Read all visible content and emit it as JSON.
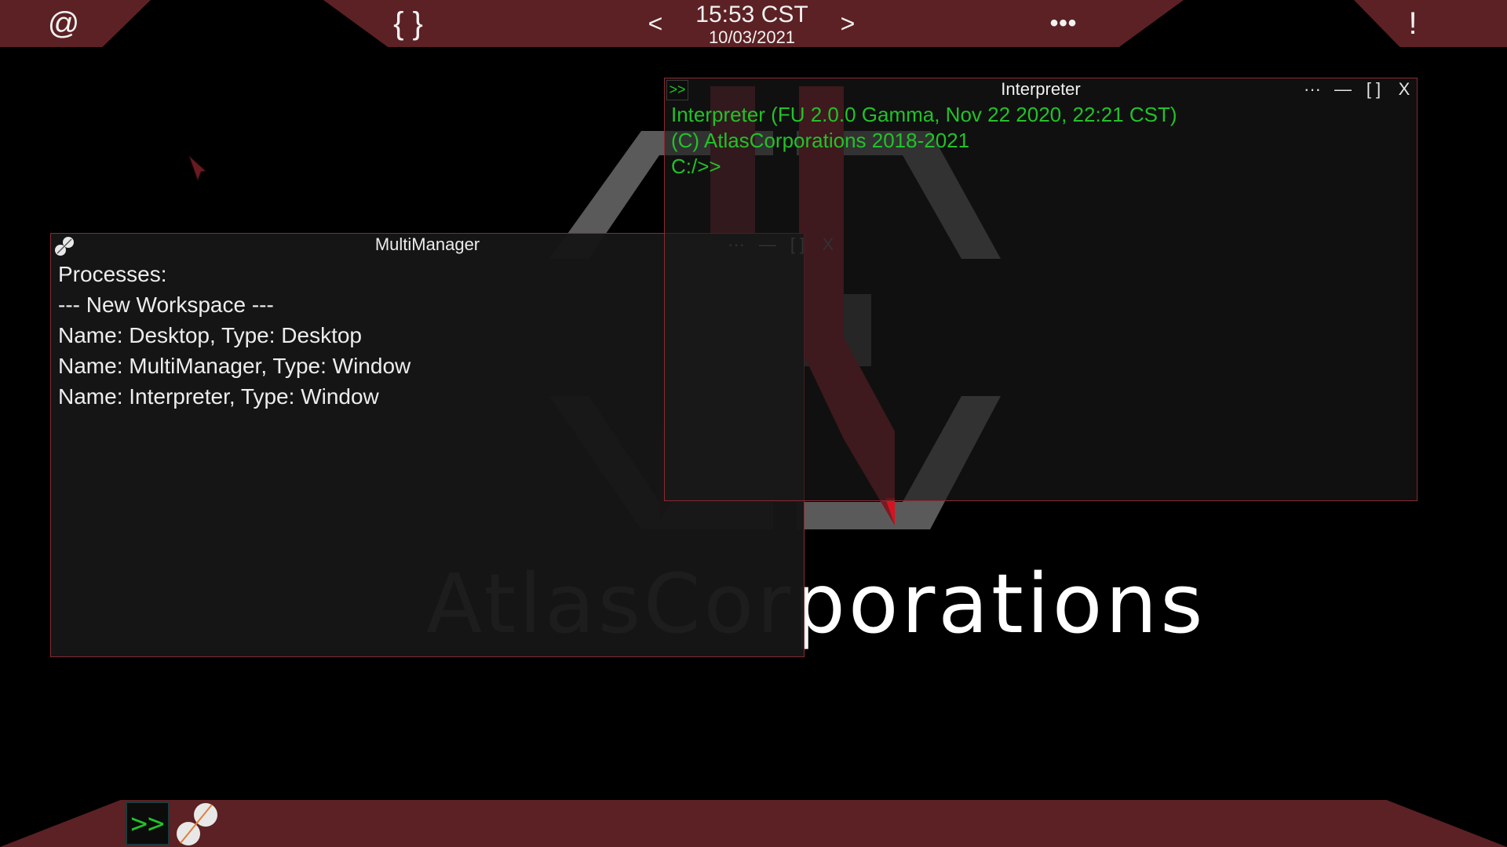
{
  "topbar": {
    "left_button": "@",
    "braces_button": "{ }",
    "prev_button": "<",
    "time": "15:53 CST",
    "date": "10/03/2021",
    "next_button": ">",
    "more_button": "•••",
    "alert_button": "!"
  },
  "wallpaper": {
    "logo_text": "AtlasCorporations"
  },
  "multimanager": {
    "title": "MultiManager",
    "controls": {
      "more": "···",
      "minimize": "—",
      "maximize": "[ ]",
      "close": "X"
    },
    "lines": [
      "Processes:",
      "--- New Workspace ---",
      "Name: Desktop, Type: Desktop",
      "Name: MultiManager, Type: Window",
      "Name: Interpreter, Type: Window"
    ]
  },
  "interpreter": {
    "title": "Interpreter",
    "icon_text": ">>",
    "controls": {
      "more": "···",
      "minimize": "—",
      "maximize": "[ ]",
      "close": "X"
    },
    "lines": [
      "Interpreter (FU 2.0.0 Gamma, Nov 22 2020, 22:21 CST)",
      "(C) AtlasCorporations 2018-2021",
      "C:/>>"
    ]
  },
  "taskbar": {
    "terminal_label": ">>",
    "apps": [
      "interpreter-icon",
      "multimanager-icon"
    ]
  },
  "colors": {
    "bar": "#5c2124",
    "accent_border": "#8a2a32",
    "terminal_green": "#22c229",
    "background": "#000000"
  }
}
